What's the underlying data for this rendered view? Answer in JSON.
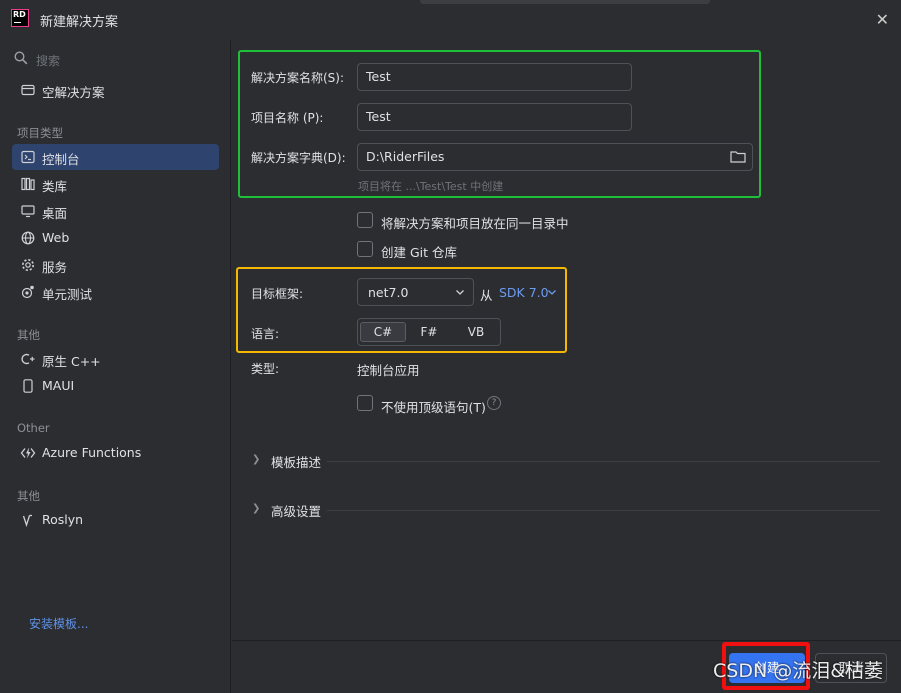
{
  "window": {
    "title": "新建解决方案",
    "logo_text": "RD"
  },
  "sidebar": {
    "search_placeholder": "搜索",
    "top_item": "空解决方案",
    "groups": [
      {
        "title": "项目类型"
      },
      {
        "title": "其他"
      },
      {
        "title": "Other"
      },
      {
        "title": "其他"
      }
    ],
    "items": [
      {
        "label": "控制台",
        "icon": "console-icon",
        "selected": true
      },
      {
        "label": "类库",
        "icon": "library-icon"
      },
      {
        "label": "桌面",
        "icon": "desktop-icon"
      },
      {
        "label": "Web",
        "icon": "globe-icon"
      },
      {
        "label": "服务",
        "icon": "gear-icon"
      },
      {
        "label": "单元测试",
        "icon": "test-icon"
      },
      {
        "label": "原生 C++",
        "icon": "cpp-icon"
      },
      {
        "label": "MAUI",
        "icon": "phone-icon"
      },
      {
        "label": "Azure Functions",
        "icon": "azure-functions-icon"
      },
      {
        "label": "Roslyn",
        "icon": "roslyn-icon"
      }
    ],
    "install_link": "安装模板..."
  },
  "form": {
    "solution_name_label": "解决方案名称(S):",
    "solution_name_value": "Test",
    "project_name_label": "项目名称 (P):",
    "project_name_value": "Test",
    "directory_label": "解决方案字典(D):",
    "directory_value": "D:\\RiderFiles",
    "location_hint": "项目将在 ...\\Test\\Test 中创建",
    "same_dir_label": "将解决方案和项目放在同一目录中",
    "git_label": "创建 Git 仓库",
    "framework_label": "目标框架:",
    "framework_value": "net7.0",
    "from_label": "从",
    "sdk_value": "SDK 7.0",
    "language_label": "语言:",
    "languages": [
      "C#",
      "F#",
      "VB"
    ],
    "selected_language": "C#",
    "type_label": "类型:",
    "type_value": "控制台应用",
    "top_level_label": "不使用顶级语句(T)",
    "template_desc_label": "模板描述",
    "advanced_label": "高级设置"
  },
  "footer": {
    "create_label": "创建",
    "cancel_label": "取消"
  },
  "watermark": "CSDN @流泪&枯萎",
  "colors": {
    "accent": "#3574f0",
    "selection": "#2e436e",
    "highlight_green": "#1fbf3a",
    "highlight_yellow": "#f5b800",
    "highlight_red": "#f01010",
    "link": "#5f92e8"
  }
}
